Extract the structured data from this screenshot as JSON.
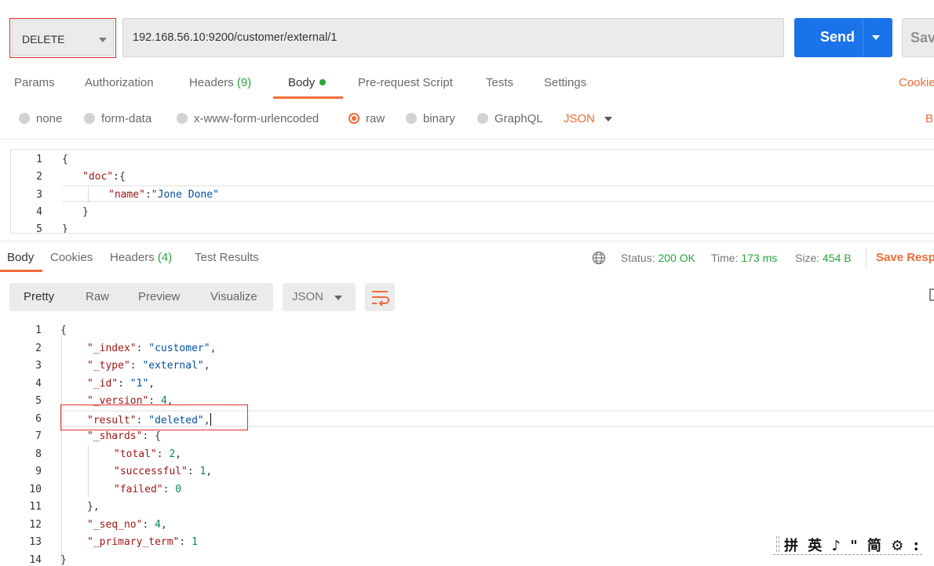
{
  "request": {
    "method": "DELETE",
    "url": "192.168.56.10:9200/customer/external/1",
    "send_label": "Send",
    "save_label": "Sav"
  },
  "request_tabs": [
    {
      "label": "Params"
    },
    {
      "label": "Authorization"
    },
    {
      "label": "Headers",
      "count": "(9)"
    },
    {
      "label": "Body"
    },
    {
      "label": "Pre-request Script"
    },
    {
      "label": "Tests"
    },
    {
      "label": "Settings"
    }
  ],
  "cookies_link": "Cookie",
  "body_types": [
    {
      "label": "none"
    },
    {
      "label": "form-data"
    },
    {
      "label": "x-www-form-urlencoded"
    },
    {
      "label": "raw"
    },
    {
      "label": "binary"
    },
    {
      "label": "GraphQL"
    }
  ],
  "body_format": "JSON",
  "beautify_link": "B",
  "request_body": {
    "line_numbers": [
      "1",
      "2",
      "3",
      "4",
      "5"
    ],
    "line1": "{",
    "doc_key": "\"doc\"",
    "doc_sep": ":{",
    "name_key": "\"name\"",
    "name_sep": ":",
    "name_val": "\"Jone Done\"",
    "line4": "}",
    "line5": "}"
  },
  "response_tabs": [
    {
      "label": "Body"
    },
    {
      "label": "Cookies"
    },
    {
      "label": "Headers",
      "count": "(4)"
    },
    {
      "label": "Test Results"
    }
  ],
  "response_meta": {
    "status_label": "Status:",
    "status_value": "200 OK",
    "time_label": "Time:",
    "time_value": "173 ms",
    "size_label": "Size:",
    "size_value": "454 B",
    "save_response": "Save Resp"
  },
  "view_modes": [
    "Pretty",
    "Raw",
    "Preview",
    "Visualize"
  ],
  "response_format": "JSON",
  "response_body": {
    "line_numbers": [
      "1",
      "2",
      "3",
      "4",
      "5",
      "6",
      "7",
      "8",
      "9",
      "10",
      "11",
      "12",
      "13",
      "14"
    ],
    "open": "{",
    "index_key": "\"_index\"",
    "index_val": "\"customer\"",
    "type_key": "\"_type\"",
    "type_val": "\"external\"",
    "id_key": "\"_id\"",
    "id_val": "\"1\"",
    "version_key": "\"_version\"",
    "version_val": "4",
    "result_key": "\"result\"",
    "result_val": "\"deleted\"",
    "shards_key": "\"_shards\"",
    "total_key": "\"total\"",
    "total_val": "2",
    "successful_key": "\"successful\"",
    "successful_val": "1",
    "failed_key": "\"failed\"",
    "failed_val": "0",
    "shards_close": "},",
    "seq_key": "\"_seq_no\"",
    "seq_val": "4",
    "term_key": "\"_primary_term\"",
    "term_val": "1",
    "close": "}"
  },
  "ime_toolbar": "拼 英 ♪ \" 简 ⚙ :",
  "colors": {
    "accent": "#f26b3a",
    "send_button": "#1a73e8",
    "success": "#26a63a",
    "highlight_box": "#e0302a"
  }
}
